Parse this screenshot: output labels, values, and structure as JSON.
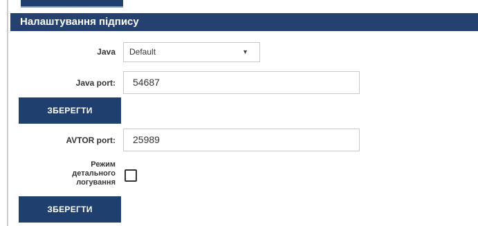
{
  "panel": {
    "title": "Налаштування підпису"
  },
  "java": {
    "label": "Java",
    "selected": "Default",
    "arrow_icon": "triangle-down"
  },
  "java_port": {
    "label": "Java port:",
    "value": "54687"
  },
  "save_java": {
    "label": "ЗБЕРЕГТИ"
  },
  "avtor_port": {
    "label": "AVTOR port:",
    "value": "25989"
  },
  "verbose_logging": {
    "label_line1": "Режим",
    "label_line2": "детального",
    "label_line3": "логування",
    "checked": false
  },
  "save_avtor": {
    "label": "ЗБЕРЕГТИ"
  },
  "colors": {
    "header_bg": "#24416f",
    "button_bg": "#1f3f6e",
    "border": "#c9c9c9"
  }
}
